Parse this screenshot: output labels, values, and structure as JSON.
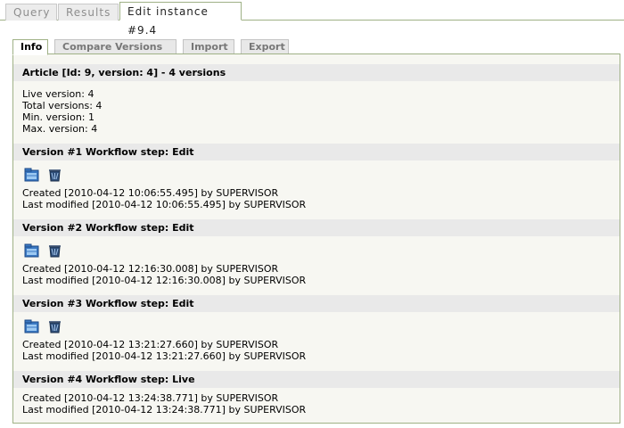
{
  "top_tabs": [
    "Query",
    "Results",
    "Edit instance #9.4"
  ],
  "sub_tabs": [
    "Info",
    "Compare Versions",
    "Import",
    "Export"
  ],
  "article": {
    "title": "Article [Id: 9, version: 4] - 4 versions",
    "lines": [
      "Live version: 4",
      "Total versions: 4",
      "Min. version: 1",
      "Max. version: 4"
    ]
  },
  "versions": [
    {
      "title": "Version #1 Workflow step: Edit",
      "created": "Created [2010-04-12 10:06:55.495] by SUPERVISOR",
      "modified": "Last modified [2010-04-12 10:06:55.495] by SUPERVISOR"
    },
    {
      "title": "Version #2 Workflow step: Edit",
      "created": "Created [2010-04-12 12:16:30.008] by SUPERVISOR",
      "modified": "Last modified [2010-04-12 12:16:30.008] by SUPERVISOR"
    },
    {
      "title": "Version #3 Workflow step: Edit",
      "created": "Created [2010-04-12 13:21:27.660] by SUPERVISOR",
      "modified": "Last modified [2010-04-12 13:21:27.660] by SUPERVISOR"
    },
    {
      "title": "Version #4 Workflow step: Live",
      "created": "Created [2010-04-12 13:24:38.771] by SUPERVISOR",
      "modified": "Last modified [2010-04-12 13:24:38.771] by SUPERVISOR"
    }
  ],
  "icons": {
    "open": "open-folder-icon",
    "delete": "delete-version-icon"
  }
}
